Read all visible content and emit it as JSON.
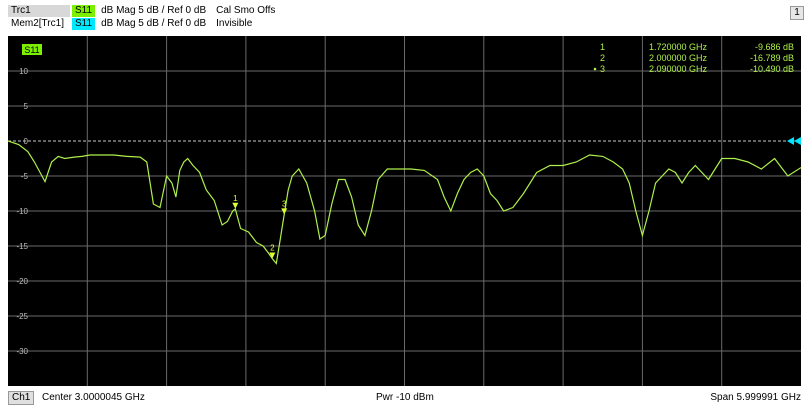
{
  "header": {
    "trace1": {
      "name": "Trc1",
      "param": "S11",
      "desc": "dB Mag  5 dB /  Ref 0 dB",
      "extra": "Cal Smo Offs"
    },
    "trace2": {
      "name": "Mem2[Trc1]",
      "param": "S11",
      "desc": "dB Mag  5 dB /  Ref 0 dB",
      "extra": "Invisible"
    },
    "window_number": "1"
  },
  "colors": {
    "background": "#000000",
    "grid": "#6a6a6a",
    "trace": "#aef04a",
    "marker": "#dfff30",
    "ref_arrow": "#00e5ff",
    "text": "#ffffff"
  },
  "chart_data": {
    "type": "line",
    "trace_label": "S11",
    "x_range_ghz": [
      4.5e-07,
      6.00000045
    ],
    "ylim": [
      -35,
      15
    ],
    "y_ticks": [
      10,
      5,
      0,
      -5,
      -10,
      -15,
      -20,
      -25,
      -30
    ],
    "y_tick_labels": [
      "10",
      "5",
      "0",
      "-5",
      "-10",
      "-15",
      "-20",
      "-25",
      "-30"
    ],
    "y_unit": "dB",
    "reference_value": 0,
    "grid": true,
    "series": [
      {
        "x": [
          0.0,
          0.08,
          0.15,
          0.2,
          0.28,
          0.33,
          0.38,
          0.43,
          0.5,
          0.56,
          0.62,
          0.72,
          0.8,
          0.9,
          1.0,
          1.05,
          1.1,
          1.15,
          1.2,
          1.24,
          1.27,
          1.3,
          1.33,
          1.36,
          1.4,
          1.45,
          1.5,
          1.56,
          1.62,
          1.66,
          1.7,
          1.72,
          1.76,
          1.82,
          1.88,
          1.93,
          1.97,
          2.0,
          2.03,
          2.06,
          2.09,
          2.12,
          2.15,
          2.2,
          2.26,
          2.32,
          2.36,
          2.4,
          2.45,
          2.5,
          2.55,
          2.6,
          2.65,
          2.7,
          2.75,
          2.8,
          2.87,
          2.95,
          3.05,
          3.15,
          3.25,
          3.3,
          3.35,
          3.4,
          3.45,
          3.5,
          3.55,
          3.6,
          3.65,
          3.7,
          3.75,
          3.82,
          3.9,
          4.0,
          4.1,
          4.2,
          4.3,
          4.4,
          4.5,
          4.58,
          4.65,
          4.7,
          4.75,
          4.8,
          4.85,
          4.9,
          5.0,
          5.05,
          5.1,
          5.15,
          5.2,
          5.25,
          5.3,
          5.35,
          5.4,
          5.5,
          5.6,
          5.7,
          5.8,
          5.9,
          6.0
        ],
        "y": [
          0,
          -0.5,
          -1.5,
          -3,
          -5.8,
          -3,
          -2.2,
          -2.5,
          -2.3,
          -2.2,
          -2,
          -2,
          -2,
          -2.2,
          -2.3,
          -3,
          -9,
          -9.5,
          -5,
          -6,
          -8,
          -4.2,
          -3,
          -2.5,
          -3.5,
          -4.5,
          -7,
          -8.5,
          -12,
          -11.5,
          -10,
          -9.7,
          -12.5,
          -13,
          -14.5,
          -15,
          -16,
          -16.8,
          -17.5,
          -14,
          -10.5,
          -7,
          -5,
          -4,
          -6,
          -10,
          -14,
          -13.5,
          -9,
          -5.5,
          -5.5,
          -8,
          -12,
          -13.5,
          -10,
          -5.5,
          -4,
          -4,
          -4,
          -4.2,
          -5.5,
          -8,
          -10,
          -7.5,
          -5.5,
          -4.5,
          -4,
          -5,
          -7.5,
          -8.5,
          -10,
          -9.5,
          -7.5,
          -4.5,
          -3.5,
          -3.5,
          -3,
          -2,
          -2.2,
          -3,
          -4,
          -6,
          -10,
          -13.5,
          -10,
          -6,
          -4,
          -4.5,
          -6,
          -4.5,
          -3.5,
          -4.5,
          -5.5,
          -4,
          -2.5,
          -2.5,
          -3,
          -4,
          -2.5,
          -5,
          -3.8
        ]
      }
    ],
    "markers": [
      {
        "label": "1",
        "freq": "1.720000 GHz",
        "value": "-9.686  dB",
        "x": 1.72,
        "y": -9.686
      },
      {
        "label": "2",
        "freq": "2.000000 GHz",
        "value": "-16.789  dB",
        "x": 2.0,
        "y": -16.789
      },
      {
        "label": "3",
        "freq": "2.090000 GHz",
        "value": "-10.490  dB",
        "x": 2.09,
        "y": -10.49
      }
    ],
    "active_marker": "3"
  },
  "footer": {
    "channel": "Ch1",
    "center": "Center  3.0000045 GHz",
    "power": "Pwr  -10 dBm",
    "span": "Span  5.999991 GHz"
  }
}
